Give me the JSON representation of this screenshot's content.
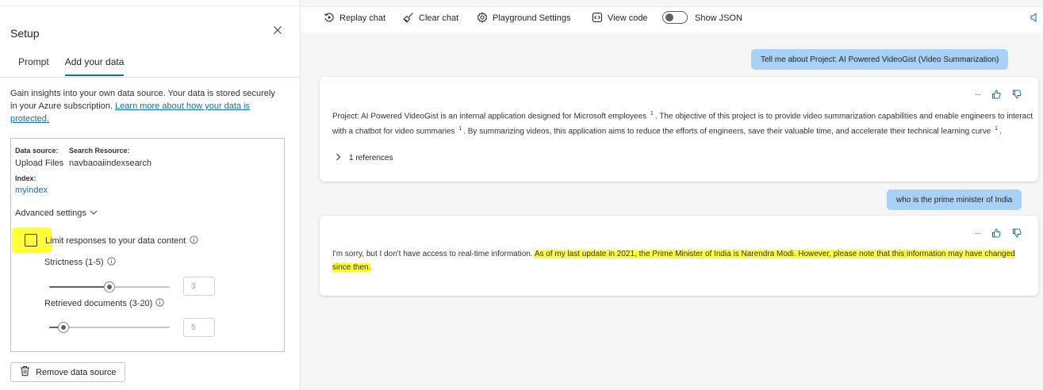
{
  "setup": {
    "title": "Setup",
    "tabs": [
      "Prompt",
      "Add your data"
    ],
    "description": "Gain insights into your own data source. Your data is stored securely in your Azure subscription. ",
    "learn_more_link": "Learn more about how your data is protected.",
    "data_source_label": "Data source:",
    "data_source_value": "Upload Files",
    "search_resource_label": "Search Resource:",
    "search_resource_value": "navbaoaiindexsearch",
    "index_label": "Index:",
    "index_value": "myindex",
    "advanced_settings": "Advanced settings",
    "limit_responses_label": "Limit responses to your data content",
    "strictness_label": "Strictness (1-5)",
    "strictness_value": "3",
    "strictness_level": 3,
    "retrieved_docs_label": "Retrieved documents (3-20)",
    "retrieved_docs_value": "5",
    "retrieved_docs_level": 5,
    "remove_button": "Remove data source"
  },
  "toolbar": {
    "replay_chat": "Replay chat",
    "clear_chat": "Clear chat",
    "playground_settings": "Playground Settings",
    "view_code": "View code",
    "show_json": "Show JSON"
  },
  "chat": {
    "user_message_1": "Tell me about Project: AI Powered VideoGist (Video Summarization)",
    "bot_message_1": {
      "part1": "Project: AI Powered VideoGist is an internal application designed for Microsoft employees",
      "cite1": "1",
      "part2": ". The objective of this project is to provide video summarization capabilities and enable engineers to interact with a chatbot for video summaries",
      "cite2": "1",
      "part3": ". By summarizing videos, this application aims to reduce the efforts of engineers, save their valuable time, and accelerate their technical learning curve",
      "cite3": "1",
      "part4": "."
    },
    "references": "1 references",
    "user_message_2": "who is the prime minister of India",
    "bot_message_2": {
      "plain": "I'm sorry, but I don't have access to real-time information. ",
      "highlighted": "As of my last update in 2021, the Prime Minister of India is Narendra Modi. However, please note that this information may have changed since then."
    },
    "more_options": "···"
  },
  "colors": {
    "accent": "#0f6cbd",
    "user_bubble": "#a8d1f5",
    "highlight": "#ffff33",
    "background": "#f5f5f5"
  }
}
